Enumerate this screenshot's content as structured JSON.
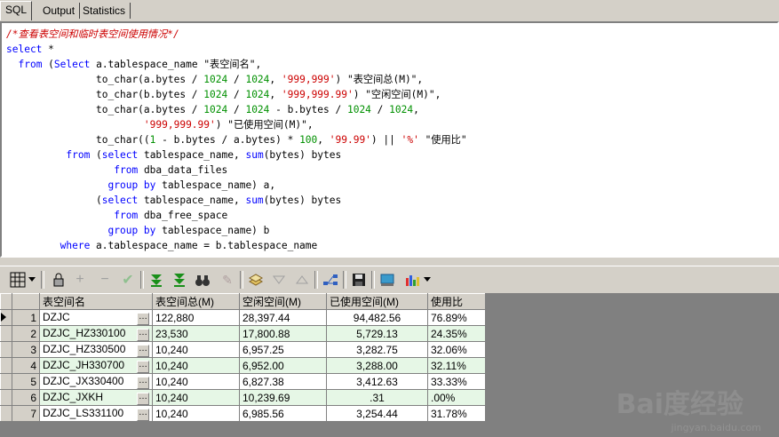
{
  "tabs": [
    {
      "label": "SQL",
      "active": true
    },
    {
      "label": "Output",
      "active": false
    },
    {
      "label": "Statistics",
      "active": false
    }
  ],
  "editor": {
    "lines": [
      [
        {
          "t": "/*查看表空间和临时表空间使用情况*/",
          "c": "cmt"
        }
      ],
      [
        {
          "t": "select",
          "c": "kw"
        },
        {
          "t": " *",
          "c": ""
        }
      ],
      [
        {
          "t": "  ",
          "c": ""
        },
        {
          "t": "from",
          "c": "kw"
        },
        {
          "t": " (",
          "c": ""
        },
        {
          "t": "Select",
          "c": "kw"
        },
        {
          "t": " a.tablespace_name \"表空间名\",",
          "c": ""
        }
      ],
      [
        {
          "t": "               to_char(a.bytes / ",
          "c": ""
        },
        {
          "t": "1024",
          "c": "num"
        },
        {
          "t": " / ",
          "c": ""
        },
        {
          "t": "1024",
          "c": "num"
        },
        {
          "t": ", ",
          "c": ""
        },
        {
          "t": "'999,999'",
          "c": "str"
        },
        {
          "t": ") \"表空间总(M)\",",
          "c": ""
        }
      ],
      [
        {
          "t": "               to_char(b.bytes / ",
          "c": ""
        },
        {
          "t": "1024",
          "c": "num"
        },
        {
          "t": " / ",
          "c": ""
        },
        {
          "t": "1024",
          "c": "num"
        },
        {
          "t": ", ",
          "c": ""
        },
        {
          "t": "'999,999.99'",
          "c": "str"
        },
        {
          "t": ") \"空闲空间(M)\",",
          "c": ""
        }
      ],
      [
        {
          "t": "               to_char(a.bytes / ",
          "c": ""
        },
        {
          "t": "1024",
          "c": "num"
        },
        {
          "t": " / ",
          "c": ""
        },
        {
          "t": "1024",
          "c": "num"
        },
        {
          "t": " - b.bytes / ",
          "c": ""
        },
        {
          "t": "1024",
          "c": "num"
        },
        {
          "t": " / ",
          "c": ""
        },
        {
          "t": "1024",
          "c": "num"
        },
        {
          "t": ",",
          "c": ""
        }
      ],
      [
        {
          "t": "                       ",
          "c": ""
        },
        {
          "t": "'999,999.99'",
          "c": "str"
        },
        {
          "t": ") \"已使用空间(M)\",",
          "c": ""
        }
      ],
      [
        {
          "t": "               to_char((",
          "c": ""
        },
        {
          "t": "1",
          "c": "num"
        },
        {
          "t": " - b.bytes / a.bytes) * ",
          "c": ""
        },
        {
          "t": "100",
          "c": "num"
        },
        {
          "t": ", ",
          "c": ""
        },
        {
          "t": "'99.99'",
          "c": "str"
        },
        {
          "t": ") || ",
          "c": ""
        },
        {
          "t": "'%'",
          "c": "str"
        },
        {
          "t": " \"使用比\"",
          "c": ""
        }
      ],
      [
        {
          "t": "          ",
          "c": ""
        },
        {
          "t": "from",
          "c": "kw"
        },
        {
          "t": " (",
          "c": ""
        },
        {
          "t": "select",
          "c": "kw"
        },
        {
          "t": " tablespace_name, ",
          "c": ""
        },
        {
          "t": "sum",
          "c": "fn"
        },
        {
          "t": "(bytes) bytes",
          "c": ""
        }
      ],
      [
        {
          "t": "                  ",
          "c": ""
        },
        {
          "t": "from",
          "c": "kw"
        },
        {
          "t": " dba_data_files",
          "c": ""
        }
      ],
      [
        {
          "t": "                 ",
          "c": ""
        },
        {
          "t": "group by",
          "c": "kw"
        },
        {
          "t": " tablespace_name) a,",
          "c": ""
        }
      ],
      [
        {
          "t": "               (",
          "c": ""
        },
        {
          "t": "select",
          "c": "kw"
        },
        {
          "t": " tablespace_name, ",
          "c": ""
        },
        {
          "t": "sum",
          "c": "fn"
        },
        {
          "t": "(bytes) bytes",
          "c": ""
        }
      ],
      [
        {
          "t": "                  ",
          "c": ""
        },
        {
          "t": "from",
          "c": "kw"
        },
        {
          "t": " dba_free_space",
          "c": ""
        }
      ],
      [
        {
          "t": "                 ",
          "c": ""
        },
        {
          "t": "group by",
          "c": "kw"
        },
        {
          "t": " tablespace_name) b",
          "c": ""
        }
      ],
      [
        {
          "t": "         ",
          "c": ""
        },
        {
          "t": "where",
          "c": "kw"
        },
        {
          "t": " a.tablespace_name = b.tablespace_name",
          "c": ""
        }
      ]
    ]
  },
  "grid": {
    "columns": [
      "表空间名",
      "表空间总(M)",
      "空闲空间(M)",
      "已使用空间(M)",
      "使用比"
    ],
    "rows": [
      [
        "1",
        "DZJC",
        "122,880",
        "28,397.44",
        "94,482.56",
        "76.89%"
      ],
      [
        "2",
        "DZJC_HZ330100",
        "23,530",
        "17,800.88",
        "5,729.13",
        "24.35%"
      ],
      [
        "3",
        "DZJC_HZ330500",
        "10,240",
        "6,957.25",
        "3,282.75",
        "32.06%"
      ],
      [
        "4",
        "DZJC_JH330700",
        "10,240",
        "6,952.00",
        "3,288.00",
        "32.11%"
      ],
      [
        "5",
        "DZJC_JX330400",
        "10,240",
        "6,827.38",
        "3,412.63",
        "33.33%"
      ],
      [
        "6",
        "DZJC_JXKH",
        "10,240",
        "10,239.69",
        ".31",
        ".00%"
      ],
      [
        "7",
        "DZJC_LS331100",
        "10,240",
        "6,985.56",
        "3,254.44",
        "31.78%"
      ]
    ]
  },
  "watermark": {
    "text": "Bai度经验",
    "sub": "jingyan.baidu.com"
  }
}
